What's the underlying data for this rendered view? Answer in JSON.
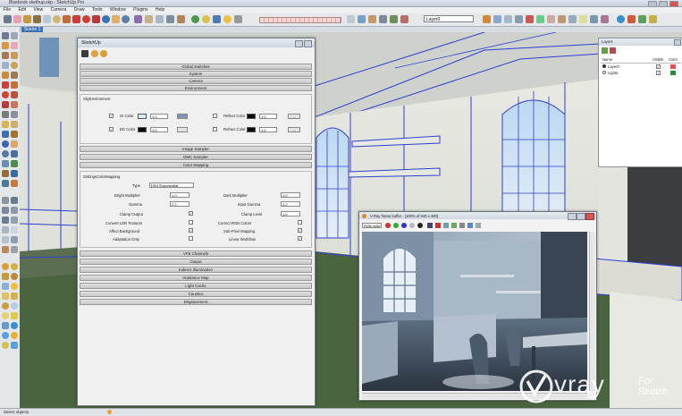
{
  "window": {
    "title": "Bluebook skethup.skp - SketchUp Pro"
  },
  "menu": [
    "File",
    "Edit",
    "View",
    "Camera",
    "Draw",
    "Tools",
    "Window",
    "Plugins",
    "Help"
  ],
  "toolbar": {
    "layer_select": "Layer0"
  },
  "scene_tab": "Scene 1",
  "vray_dialog": {
    "title": "SketchUp",
    "sections_top": [
      "Global Switches",
      "System",
      "Camera",
      "Environment"
    ],
    "environment": {
      "header": "SkyEnvironment",
      "gi_label": "GI Color",
      "gi_value": "1.0",
      "bg_label": "BG Color",
      "bg_value": "1.0",
      "reflect_label": "Reflect Color",
      "reflect_value": "1.0",
      "refract_label": "Refract Color",
      "refract_value": "1.0",
      "btn_label": "...",
      "check_mark": "✓"
    },
    "sections_mid": [
      "Image Sampler",
      "DMC Sampler",
      "Color Mapping"
    ],
    "color_mapping": {
      "header": "SettingsColorMapping",
      "type_label": "Type",
      "type_value": "HSV Exponential",
      "bright_label": "Bright Multiplier",
      "bright_value": "1.0",
      "dark_label": "Dark Multiplier",
      "dark_value": "1.0",
      "gamma_label": "Gamma",
      "gamma_value": "2.2",
      "input_gamma_label": "Input Gamma",
      "input_gamma_value": "2.2",
      "clamp_label": "Clamp Output",
      "clamp_level_label": "Clamp Level",
      "clamp_level_value": "1.0",
      "convert_ldr_label": "Convert LDR Textures",
      "correct_rgb_label": "Correct RGB Colors",
      "affect_bg_label": "Affect Background",
      "subpixel_label": "Sub-Pixel Mapping",
      "adaptation_label": "Adaptation Only",
      "linear_wf_label": "Linear Workflow"
    },
    "sections_bottom": [
      "VFB Channels",
      "Output",
      "Indirect Illumination",
      "Irradiance Map",
      "Light Cache",
      "Caustics",
      "Displacement"
    ]
  },
  "layers_panel": {
    "title": "Layers",
    "col_name": "Name",
    "col_visible": "Visible",
    "col_color": "Color",
    "rows": [
      {
        "name": "Layer0",
        "color": "#e05050"
      },
      {
        "name": "Lights",
        "color": "#2f8a3a"
      }
    ],
    "check_mark": "✓"
  },
  "frame_buffer": {
    "title": "V-Ray frame buffer - [100% of 640 x 480]",
    "channel": "RGB color"
  },
  "watermark": {
    "brand": "vray",
    "tag": "For Sketch"
  },
  "status": {
    "text": "Select objects"
  },
  "colors": {
    "accent": "#3d6fb5",
    "floor": "#4b6440",
    "wireframe": "#2e3fd0"
  }
}
